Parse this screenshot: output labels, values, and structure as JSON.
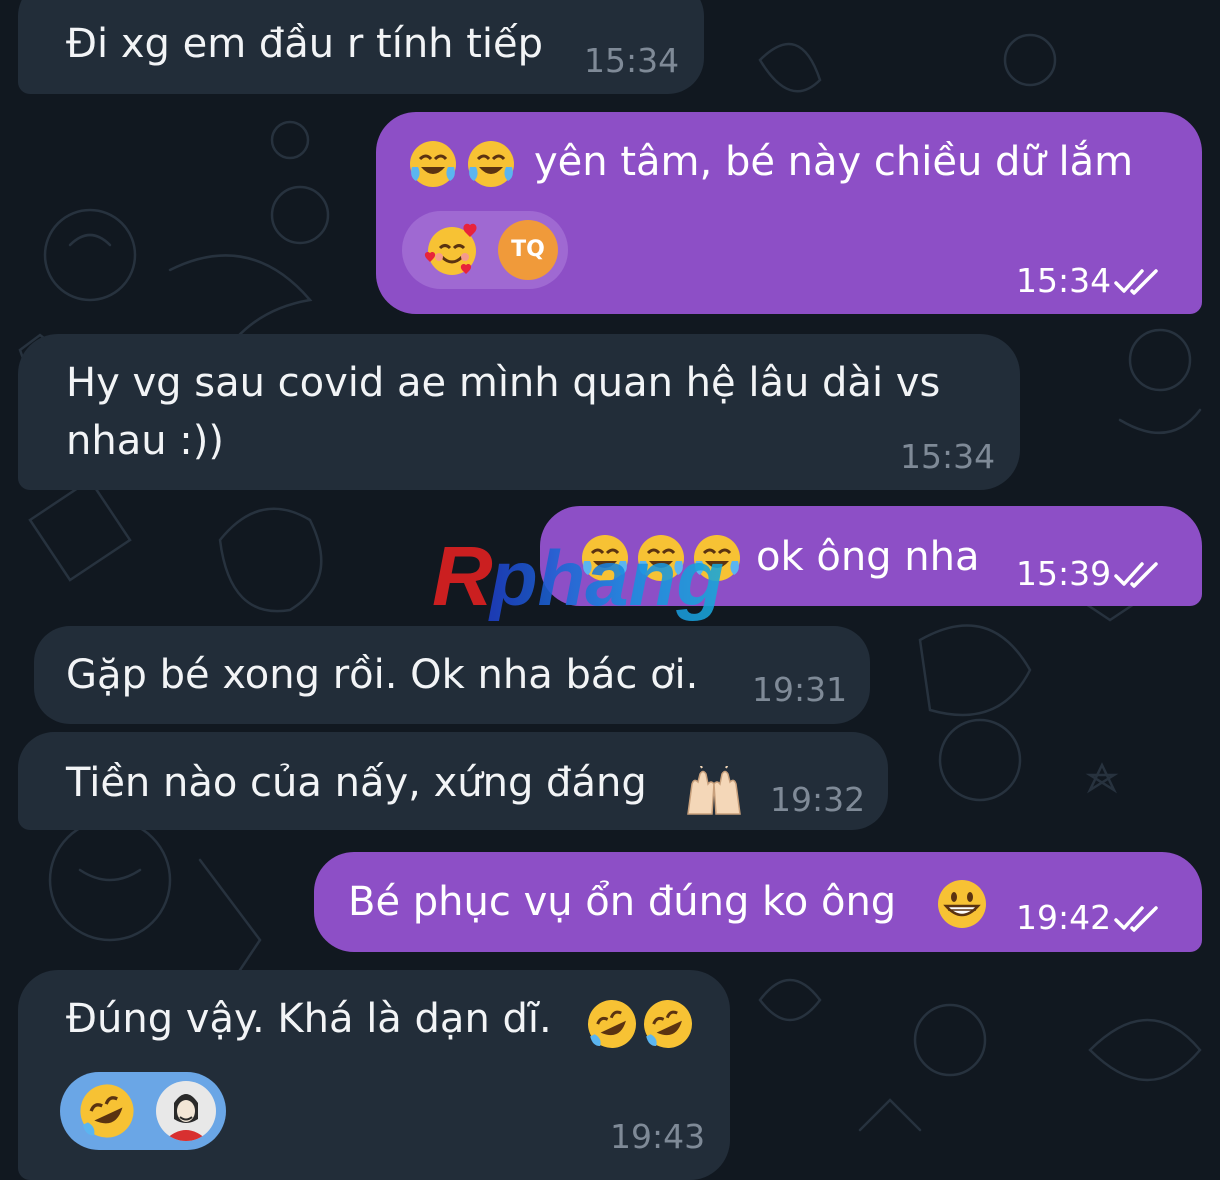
{
  "colors": {
    "background": "#111820",
    "incoming_bubble": "#222d39",
    "outgoing_bubble": "#8d4fc6",
    "incoming_time": "#7f8a97",
    "outgoing_reaction_pill": "#9f69d2",
    "incoming_reaction_pill": "#6aa6e6"
  },
  "messages": [
    {
      "direction": "incoming",
      "text": "Đi xg em đầu r tính tiếp",
      "time": "15:34"
    },
    {
      "direction": "outgoing",
      "text": "yên tâm, bé này chiều dữ lắm",
      "leading_emoji": [
        "face-with-tears-of-joy",
        "face-with-tears-of-joy"
      ],
      "time": "15:34",
      "status": "read",
      "reactions": [
        {
          "emoji": "smiling-face-with-hearts",
          "avatar_initials": "TQ"
        }
      ]
    },
    {
      "direction": "incoming",
      "text": "Hy vg sau covid ae mình quan hệ lâu dài vs nhau :))",
      "time": "15:34"
    },
    {
      "direction": "outgoing",
      "text": "ok ông nha",
      "leading_emoji": [
        "face-with-tears-of-joy",
        "face-with-tears-of-joy",
        "face-with-tears-of-joy"
      ],
      "time": "15:39",
      "status": "read"
    },
    {
      "direction": "incoming",
      "text": "Gặp bé xong rồi. Ok nha bác ơi.",
      "time": "19:31"
    },
    {
      "direction": "incoming",
      "text": "Tiền nào của nấy, xứng đáng",
      "trailing_emoji": [
        "raising-hands"
      ],
      "time": "19:32"
    },
    {
      "direction": "outgoing",
      "text": "Bé phục vụ ổn đúng ko ông",
      "trailing_emoji": [
        "grinning-face"
      ],
      "time": "19:42",
      "status": "read"
    },
    {
      "direction": "incoming",
      "text": "Đúng vậy. Khá là dạn dĩ.",
      "trailing_emoji": [
        "rolling-on-floor-laughing",
        "rolling-on-floor-laughing"
      ],
      "time": "19:43",
      "reactions": [
        {
          "emoji": "rolling-on-floor-laughing",
          "avatar_icon": "masked-person-avatar"
        }
      ]
    }
  ],
  "watermark": {
    "text": "Rphang"
  }
}
